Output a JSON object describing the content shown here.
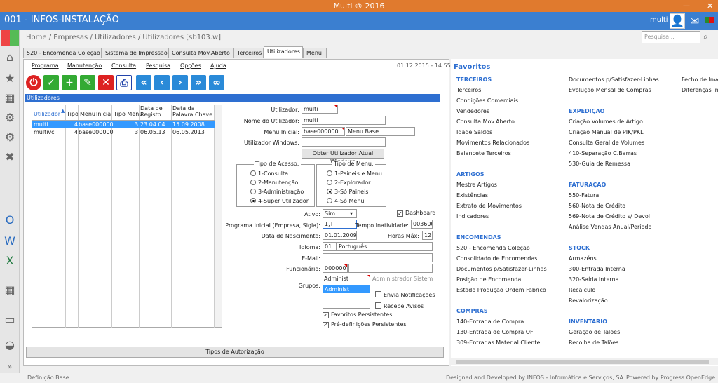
{
  "window": {
    "title": "Multi ® 2016"
  },
  "app": {
    "title": "001 - INFOS-INSTALAÇÃO",
    "user": "multi"
  },
  "breadcrumb": "Home / Empresas / Utilizadores / Utilizadores [sb103.w]",
  "search": {
    "placeholder": "Pesquisa..."
  },
  "tabs": [
    "520 - Encomenda Coleção",
    "Sistema de Impressão",
    "Consulta Mov.Aberto",
    "Terceiros",
    "Utilizadores",
    "Menu"
  ],
  "menu": [
    "Programa",
    "Manutenção",
    "Consulta",
    "Pesquisa",
    "Opções",
    "Ajuda"
  ],
  "datetime": "01.12.2015 - 14:55",
  "section_title": "Utilizadores",
  "grid": {
    "headers": [
      "Utilizador",
      "Tipo",
      "Menu",
      "Inicial",
      "Tipo Menu",
      "Data de Registo",
      "Data da Palavra Chave"
    ],
    "rows": [
      {
        "utilizador": "multi",
        "tipo": "4",
        "menu": "base000000",
        "tipomenu": "3",
        "registo": "23.04.04",
        "palavra": "15.09.2008"
      },
      {
        "utilizador": "multivc",
        "tipo": "4",
        "menu": "base000000",
        "tipomenu": "3",
        "registo": "06.05.13",
        "palavra": "06.05.2013"
      }
    ]
  },
  "form": {
    "utilizador_label": "Utilizador:",
    "utilizador": "multi",
    "nome_label": "Nome do Utilizador:",
    "nome": "multi",
    "menu_inicial_label": "Menu Inicial:",
    "menu_inicial": "base000000",
    "menu_base": "Menu Base",
    "windows_label": "Utilizador Windows:",
    "windows": "",
    "obter_button": "Obter Utilizador Atual Windows",
    "tipo_acesso_title": "Tipo de Acesso:",
    "tipo_acesso": [
      "1-Consulta",
      "2-Manutenção",
      "3-Administração",
      "4-Super Utilizador"
    ],
    "tipo_menu_title": "Tipo de Menu:",
    "tipo_menu": [
      "1-Paineis e Menu",
      "2-Explorador",
      "3-Só Paineis",
      "4-Só Menu"
    ],
    "ativo_label": "Ativo:",
    "ativo": "Sim",
    "dashboard": "Dashboard",
    "programa_label": "Programa Inicial (Empresa, Sigla):",
    "programa": "1,T",
    "tempo_label": "Tempo Inatividade:",
    "tempo": "003600",
    "nascimento_label": "Data de Nascimento:",
    "nascimento": "01.01.2009",
    "horas_label": "Horas Máx:",
    "horas": "12",
    "idioma_label": "Idioma:",
    "idioma_code": "01",
    "idioma": "Português",
    "email_label": "E-Mail:",
    "email": "",
    "funcionario_label": "Funcionário:",
    "funcionario": "000000",
    "funcionario_nome": "",
    "grupos_label": "Grupos:",
    "grupo_value": "Administ",
    "grupo_desc": "Administrador Sistem",
    "grupo_list": [
      "Administ"
    ],
    "envia": "Envia Notificações",
    "recebe": "Recebe Avisos",
    "favoritos": "Favoritos Persistentes",
    "predef": "Pré-definições Persistentes"
  },
  "auth_button": "Tipos de Autorização",
  "favorites": {
    "title": "Favoritos",
    "col1": [
      {
        "head": "TERCEIROS",
        "items": [
          "Terceiros",
          "Condições Comerciais",
          "Vendedores",
          "Consulta Mov.Aberto",
          "Idade Saldos",
          "Movimentos Relacionados",
          "Balancete Terceiros"
        ]
      },
      {
        "head": "ARTIGOS",
        "items": [
          "Mestre Artigos",
          "Existências",
          "Extrato de Movimentos",
          "Indicadores"
        ]
      },
      {
        "head": "ENCOMENDAS",
        "items": [
          "520 - Encomenda Coleção",
          "Consolidado de Encomendas",
          "Documentos p/Satisfazer-Linhas",
          "Posição de Encomenda",
          "Estado Produção Ordem Fabrico"
        ]
      },
      {
        "head": "COMPRAS",
        "items": [
          "140-Entrada de Compra",
          "130-Entrada de Compra OF",
          "309-Entradas Material Cliente"
        ]
      }
    ],
    "col2": [
      {
        "head": "",
        "items": [
          "Documentos p/Satisfazer-Linhas",
          "Evolução Mensal de Compras"
        ]
      },
      {
        "head": "EXPEDIÇAO",
        "items": [
          "Criação Volumes de Artigo",
          "Criação Manual de PIK/PKL",
          "Consulta Geral de Volumes",
          "410-Separação C.Barras",
          "530-Guia de Remessa"
        ]
      },
      {
        "head": "FATURAÇAO",
        "items": [
          "550-Fatura",
          "560-Nota de Crédito",
          "569-Nota de Crédito s/ Devol",
          "Análise Vendas Anual/Período"
        ]
      },
      {
        "head": "STOCK",
        "items": [
          "Armazéns",
          "300-Entrada Interna",
          "320-Saída Interna",
          "Recálculo",
          "Revalorização"
        ]
      },
      {
        "head": "INVENTARIO",
        "items": [
          "Geração de Talões",
          "Recolha de Talões"
        ]
      }
    ],
    "col3": [
      "Fecho de Inve",
      "Diferenças In"
    ]
  },
  "footer": {
    "left": "Definição Base",
    "center": "Designed and Developed by INFOS - Informática e Serviços, SA",
    "right": "Powered by Progress OpenEdge"
  },
  "colors": {
    "title_bar": "#e07a2e",
    "app_bar": "#3b7fd0",
    "accent": "#2e6fd1",
    "selected_row": "#3399ff"
  }
}
